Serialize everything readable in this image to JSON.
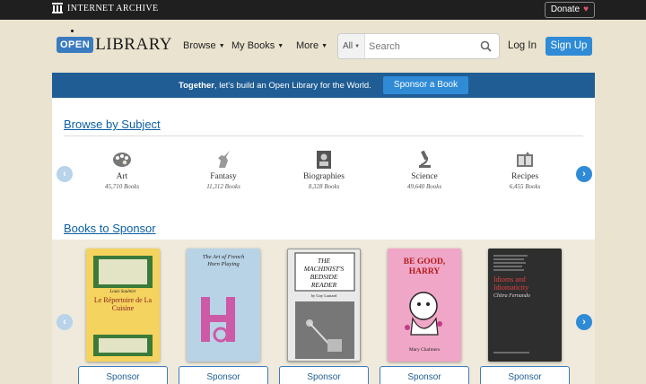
{
  "ia_bar": {
    "logo_text": "INTERNET ARCHIVE",
    "donate_label": "Donate",
    "donate_icon": "heart-icon"
  },
  "header": {
    "logo_open": "OPEN",
    "logo_library": "LIBRARY",
    "nav": [
      {
        "label": "Browse"
      },
      {
        "label": "My Books"
      },
      {
        "label": "More"
      }
    ],
    "search": {
      "scope": "All",
      "placeholder": "Search"
    },
    "login_label": "Log In",
    "signup_label": "Sign Up"
  },
  "banner": {
    "bold_text": "Together",
    "text": ", let's build an Open Library for the World.",
    "button_label": "Sponsor a Book"
  },
  "browse_by_subject": {
    "title": "Browse by Subject",
    "subjects": [
      {
        "name": "Art",
        "count": "45,710 Books",
        "icon": "palette-icon"
      },
      {
        "name": "Fantasy",
        "count": "11,312 Books",
        "icon": "unicorn-icon"
      },
      {
        "name": "Biographies",
        "count": "8,328 Books",
        "icon": "portrait-book-icon"
      },
      {
        "name": "Science",
        "count": "49,640 Books",
        "icon": "microscope-icon"
      },
      {
        "name": "Recipes",
        "count": "6,455 Books",
        "icon": "recipe-book-icon"
      }
    ]
  },
  "books_to_sponsor": {
    "title": "Books to Sponsor",
    "books": [
      {
        "cover_title": "Le Répertoire de La Cuisine",
        "author": "Louis Saulnier",
        "sponsor_label": "Sponsor"
      },
      {
        "cover_title": "The Art of French Horn Playing",
        "author": "",
        "sponsor_label": "Sponsor"
      },
      {
        "cover_title": "THE MACHINIST'S BEDSIDE READER",
        "author": "by Guy Lautard",
        "sponsor_label": "Sponsor"
      },
      {
        "cover_title": "BE GOOD, HARRY",
        "author": "Mary Chalmers",
        "sponsor_label": "Sponsor"
      },
      {
        "cover_title": "Idioms and Idiomaticity",
        "author": "Chitra Fernando",
        "sponsor_label": "Sponsor"
      }
    ]
  },
  "colors": {
    "banner_blue": "#1f5d94",
    "button_blue": "#2f8bd6",
    "page_bg": "#e9e3cf"
  }
}
